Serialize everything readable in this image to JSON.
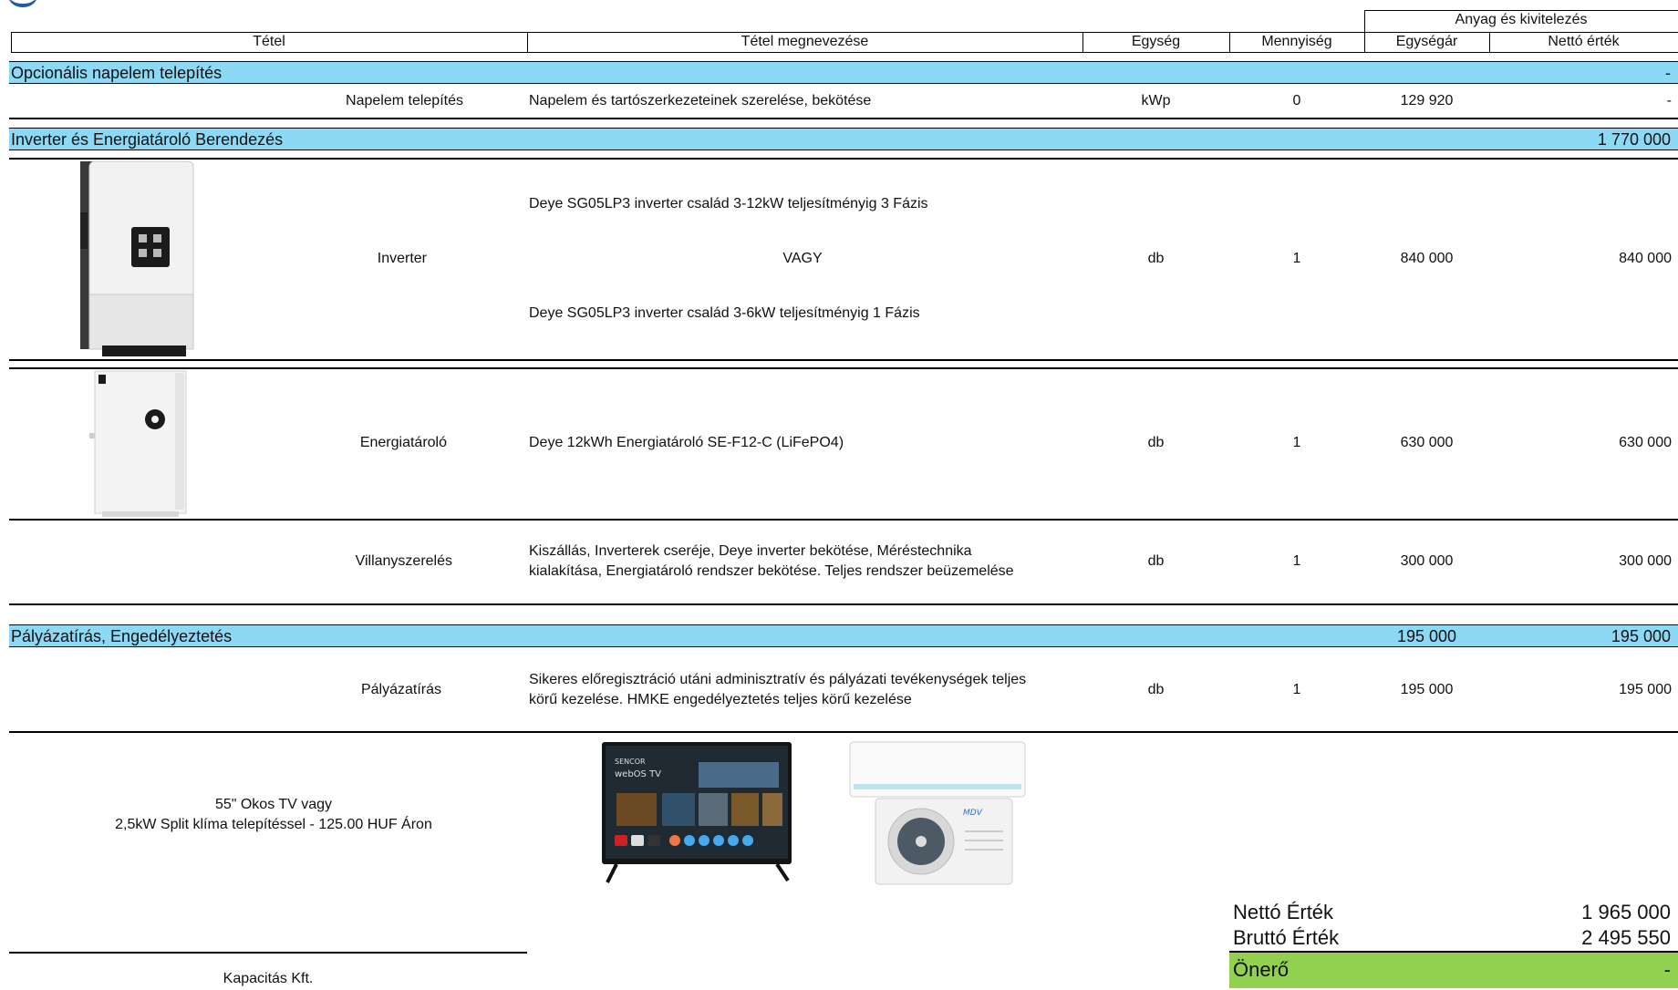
{
  "header": {
    "group_label": "Anyag és kivitelezés",
    "cols": {
      "tetel": "Tétel",
      "megnevezes": "Tétel megnevezése",
      "egyseg": "Egység",
      "mennyiseg": "Mennyiség",
      "egysegar": "Egységár",
      "netto": "Nettó érték"
    }
  },
  "sections": {
    "napelem": {
      "title": "Opcionális napelem telepítés",
      "total": "-",
      "row": {
        "tetel": "Napelem telepítés",
        "desc": "Napelem és tartószerkezeteinek szerelése, bekötése",
        "unit": "kWp",
        "qty": "0",
        "price": "129 920",
        "net": "-"
      }
    },
    "inverter": {
      "title": "Inverter és Energiatároló Berendezés",
      "total": "1 770 000",
      "inverter_row": {
        "tetel": "Inverter",
        "desc1": "Deye SG05LP3 inverter család 3-12kW teljesítményig 3 Fázis",
        "desc_or": "VAGY",
        "desc2": "Deye SG05LP3 inverter család 3-6kW teljesítményig 1 Fázis",
        "unit": "db",
        "qty": "1",
        "price": "840 000",
        "net": "840 000"
      },
      "storage_row": {
        "tetel": "Energiatároló",
        "desc": "Deye 12kWh Energiatároló SE-F12-C (LiFePO4)",
        "unit": "db",
        "qty": "1",
        "price": "630 000",
        "net": "630 000"
      },
      "electric_row": {
        "tetel": "Villanyszerelés",
        "desc1": "Kiszállás, Inverterek cseréje, Deye inverter bekötése, Méréstechnika",
        "desc2": "kialakítása,  Energiatároló rendszer bekötése. Teljes rendszer beüzemelése",
        "unit": "db",
        "qty": "1",
        "price": "300 000",
        "net": "300 000"
      }
    },
    "palyazat": {
      "title": "Pályázatírás, Engedélyeztetés",
      "price_total": "195 000",
      "total": "195 000",
      "row": {
        "tetel": "Pályázatírás",
        "desc1": "Sikeres előregisztráció utáni adminisztratív és pályázati tevékenységek teljes",
        "desc2": "körű kezelése. HMKE engedélyeztetés teljes körű kezelése",
        "unit": "db",
        "qty": "1",
        "price": "195 000",
        "net": "195 000"
      }
    }
  },
  "bonus": {
    "line1": "55\" Okos TV vagy",
    "line2": "2,5kW Split klíma telepítéssel - 125.00 HUF Áron",
    "tv_brand": "SENCOR",
    "tv_os": "webOS TV",
    "ac_brand": "MDV"
  },
  "totals": {
    "netto_label": "Nettó Érték",
    "netto_value": "1 965 000",
    "brutto_label": "Bruttó Érték",
    "brutto_value": "2 495 550",
    "oneró_label": "Önerő",
    "oneró_value": "-"
  },
  "signature": {
    "company": "Kapacitás Kft."
  },
  "colors": {
    "band": "#8cd9f5",
    "total_green": "#92d050"
  }
}
